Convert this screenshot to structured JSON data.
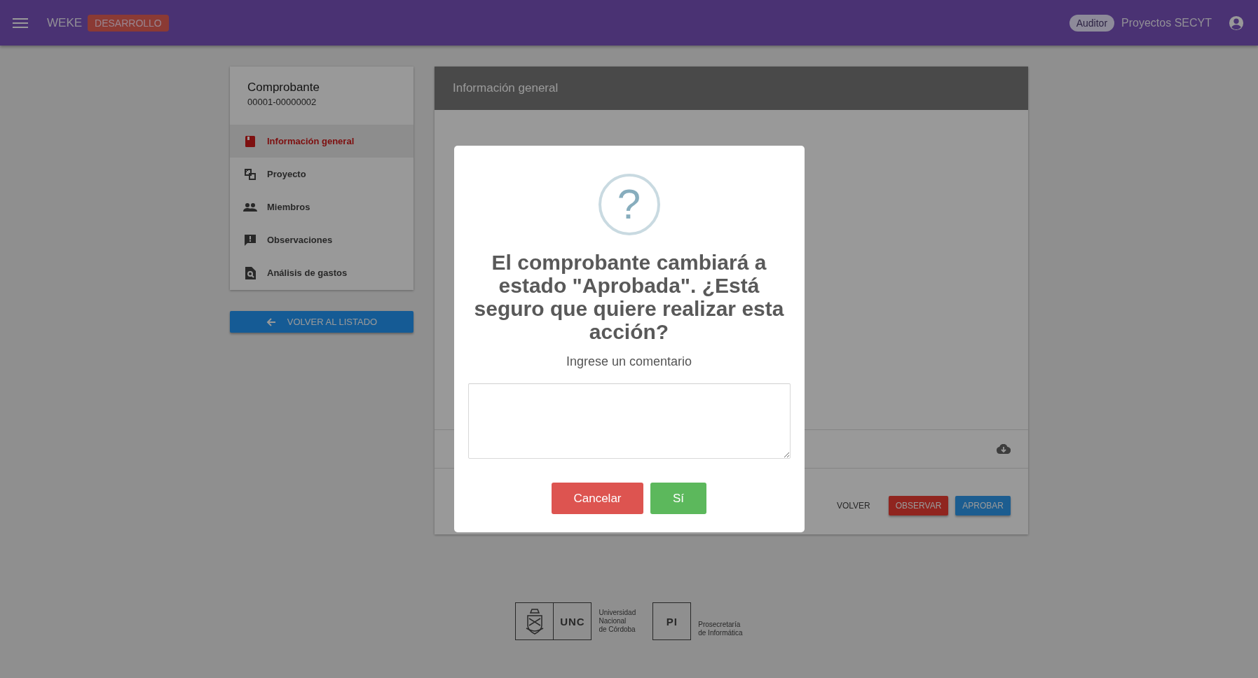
{
  "header": {
    "title": "WEKE",
    "environment_badge": "DESARROLLO",
    "role_badge": "Auditor",
    "project": "Proyectos SECYT"
  },
  "sidebar": {
    "title": "Comprobante",
    "number": "00001-00000002",
    "items": [
      {
        "label": "Información general",
        "selected": true
      },
      {
        "label": "Proyecto",
        "selected": false
      },
      {
        "label": "Miembros",
        "selected": false
      },
      {
        "label": "Observaciones",
        "selected": false
      },
      {
        "label": "Análisis de gastos",
        "selected": false
      }
    ],
    "back_button": "VOLVER AL LISTADO"
  },
  "panel": {
    "title": "Información general",
    "actions": [
      {
        "label": "VOLVER",
        "kind": "text"
      },
      {
        "label": "OBSERVAR",
        "kind": "warn"
      },
      {
        "label": "APROBAR",
        "kind": "primary"
      }
    ]
  },
  "dialog": {
    "icon": "?",
    "message": "El comprobante cambiará a estado \"Aprobada\". ¿Está seguro que quiere realizar esta acción?",
    "prompt": "Ingrese un comentario",
    "buttons": [
      {
        "label": "Cancelar",
        "kind": "cancel"
      },
      {
        "label": "Sí",
        "kind": "confirm"
      }
    ]
  },
  "footer": {
    "unc": {
      "abbr": "UNC",
      "name_lines": [
        "Universidad",
        "Nacional",
        "de Córdoba"
      ]
    },
    "pi": {
      "abbr": "PI",
      "name_lines": [
        "Prosecretaría",
        "de Informática"
      ]
    }
  }
}
